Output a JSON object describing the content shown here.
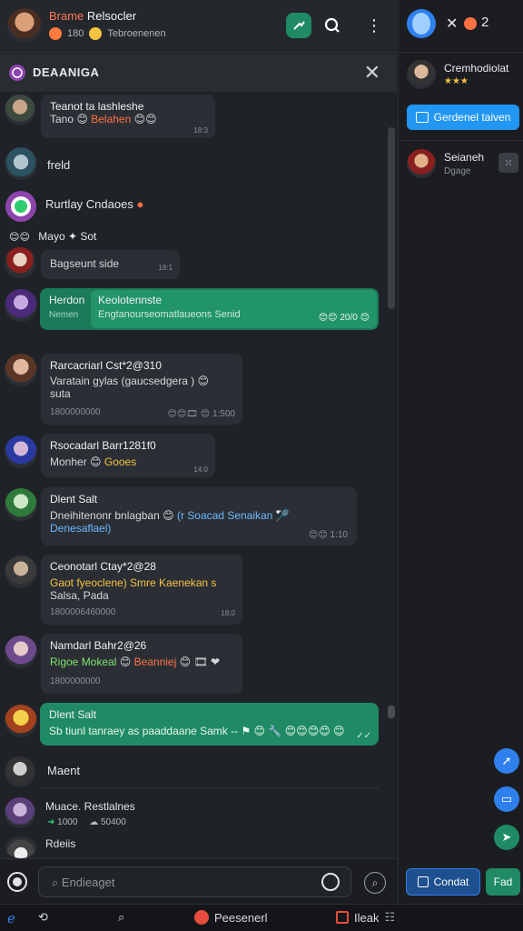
{
  "header": {
    "title_accent": "Brame",
    "title_rest": "Relsocler",
    "sub_count": "180",
    "sub_text": "Tebroenenen",
    "section_label": "DEAANIGA"
  },
  "messages": [
    {
      "name": "Teanot ta lashleshe",
      "text": "Tano",
      "text_colored": "Belahen",
      "time": "18:3"
    },
    {
      "plain": "freld"
    },
    {
      "plain": "Rurtlay Cndaoes"
    },
    {
      "plain": "Mayo",
      "plain2": "Sot"
    },
    {
      "name": "Bagseunt side",
      "time": "18:1"
    },
    {
      "name": "Herdon",
      "green_title": "Keolotennste",
      "green_text": "Engtanourseomatlaueons Senid",
      "green_meta": "20/0",
      "small": "Nemen"
    },
    {
      "name": "Rarcacriarl Cst*2@310",
      "text": "Varatain gylas (gaucsedgera )",
      "text2": "suta",
      "meta": "1800000000",
      "time": "1:500"
    },
    {
      "name": "Rsocadarl Barr1281f0",
      "text": "Monher",
      "text_colored": "Gooes",
      "time": "14:0"
    },
    {
      "name": "Dlent Salt",
      "text": "Dneihitenonr bnlagban",
      "text_blue": "(r Soacad Senaikan",
      "text_blue2": "Denesaflael)",
      "time": "1:10"
    },
    {
      "name": "Ceonotarl Ctay*2@28",
      "text_yellow": "Gaot fyeoclene) Smre Kaenekan s",
      "text": "Salsa, Pada",
      "meta": "1800006460000",
      "time": "18:0"
    },
    {
      "name": "Namdarl Bahr2@26",
      "text_green": "Rigoe Mokeal",
      "text_orange": "Beanniej",
      "meta": "1800000000"
    },
    {
      "name": "Dlent Salt",
      "green_text": "Sb tiunl tanraey as paaddaane Samk --",
      "green_meta": "✓✓"
    },
    {
      "plain": "Maent"
    },
    {
      "name": "Muace. Restlalnes",
      "meta1": "1000",
      "meta2": "50400"
    },
    {
      "plain": "Rdeiis"
    }
  ],
  "composer": {
    "placeholder": "Endieaget"
  },
  "right": {
    "top_count": "2",
    "contact_name": "Cremhodiolat",
    "contact_stars": "★★★",
    "action_button": "Gerdenel taiven",
    "list_name": "Seianeh",
    "list_sub": "Dgage",
    "btn_contact": "Condat",
    "btn_fad": "Fad"
  },
  "taskbar": {
    "item1": "Peesenerl",
    "item2": "Ileak"
  },
  "colors": {
    "accent_green": "#1f8a63",
    "accent_blue": "#2f80ed",
    "orange": "#ff7043"
  }
}
